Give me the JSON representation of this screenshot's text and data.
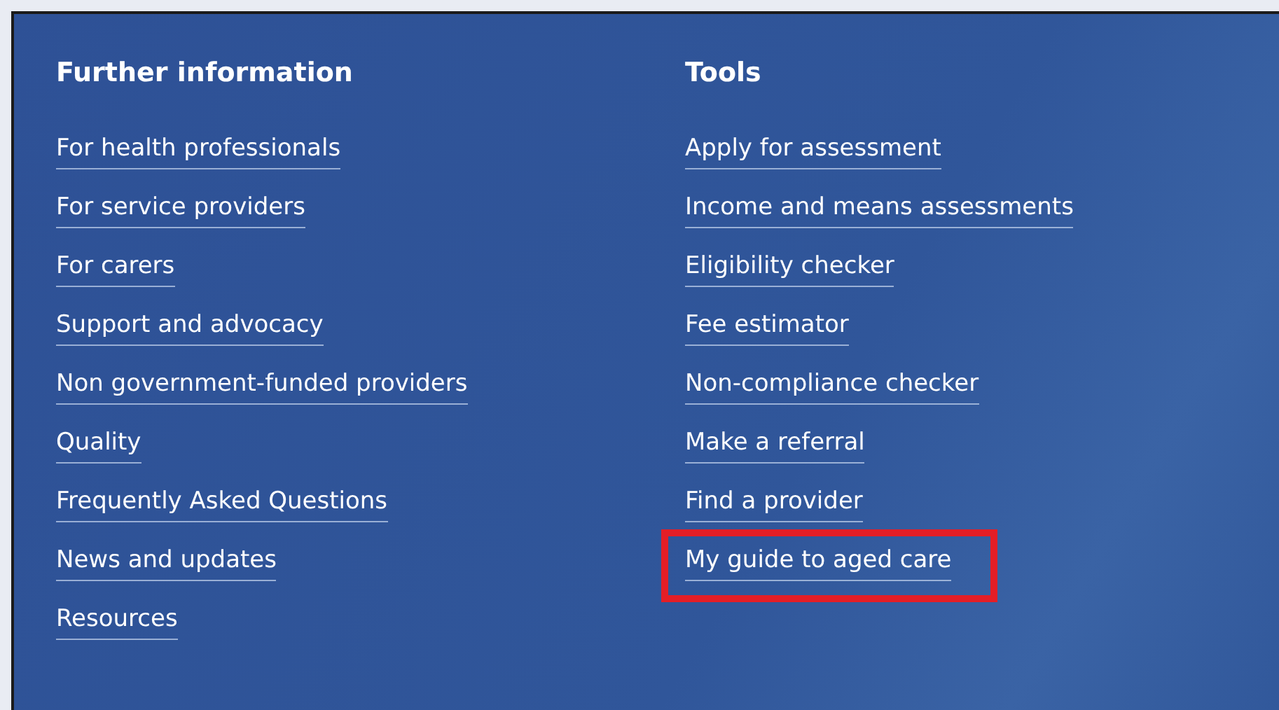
{
  "columns": [
    {
      "heading": "Further information",
      "links": [
        {
          "label": "For health professionals",
          "highlighted": false
        },
        {
          "label": "For service providers",
          "highlighted": false
        },
        {
          "label": "For carers",
          "highlighted": false
        },
        {
          "label": "Support and advocacy",
          "highlighted": false
        },
        {
          "label": "Non government-funded providers",
          "highlighted": false
        },
        {
          "label": "Quality",
          "highlighted": false
        },
        {
          "label": "Frequently Asked Questions",
          "highlighted": false
        },
        {
          "label": "News and updates",
          "highlighted": false
        },
        {
          "label": "Resources",
          "highlighted": false
        }
      ]
    },
    {
      "heading": "Tools",
      "links": [
        {
          "label": "Apply for assessment",
          "highlighted": false
        },
        {
          "label": "Income and means assessments",
          "highlighted": false
        },
        {
          "label": "Eligibility checker",
          "highlighted": false
        },
        {
          "label": "Fee estimator",
          "highlighted": false
        },
        {
          "label": "Non-compliance checker",
          "highlighted": false
        },
        {
          "label": "Make a referral",
          "highlighted": false
        },
        {
          "label": "Find a provider",
          "highlighted": false
        },
        {
          "label": "My guide to aged care",
          "highlighted": true
        }
      ]
    }
  ]
}
